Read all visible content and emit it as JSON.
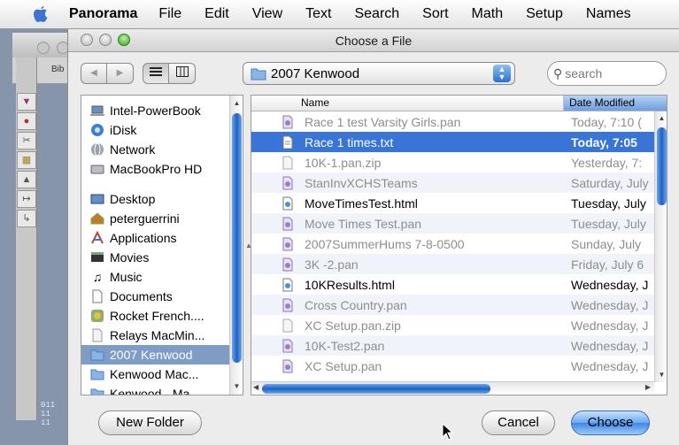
{
  "menubar": {
    "app": "Panorama",
    "items": [
      "File",
      "Edit",
      "View",
      "Text",
      "Search",
      "Sort",
      "Math",
      "Setup",
      "Names"
    ]
  },
  "background_window": {
    "title_fragment": "Bib",
    "code_fragment": "011\n11\n11"
  },
  "dialog": {
    "title": "Choose a File",
    "location": "2007 Kenwood",
    "search_placeholder": "search",
    "sidebar": {
      "devices": [
        {
          "label": "Intel-PowerBook",
          "icon": "laptop-icon"
        },
        {
          "label": "iDisk",
          "icon": "idisk-icon"
        },
        {
          "label": "Network",
          "icon": "network-icon"
        },
        {
          "label": "MacBookPro HD",
          "icon": "hard-drive-icon"
        }
      ],
      "places": [
        {
          "label": "Desktop",
          "icon": "desktop-icon"
        },
        {
          "label": "peterguerrini",
          "icon": "home-icon"
        },
        {
          "label": "Applications",
          "icon": "applications-icon"
        },
        {
          "label": "Movies",
          "icon": "movies-icon"
        },
        {
          "label": "Music",
          "icon": "music-icon"
        },
        {
          "label": "Documents",
          "icon": "documents-icon"
        },
        {
          "label": "Rocket French....",
          "icon": "app-icon"
        },
        {
          "label": "Relays MacMin...",
          "icon": "document-icon"
        },
        {
          "label": "2007 Kenwood",
          "icon": "folder-icon",
          "selected": true
        },
        {
          "label": "Kenwood Mac...",
          "icon": "folder-icon"
        },
        {
          "label": "Kenwood - Ma...",
          "icon": "folder-icon"
        }
      ]
    },
    "columns": {
      "name": "Name",
      "date": "Date Modified"
    },
    "files": [
      {
        "name": "Race 1 test Varsity Girls.pan",
        "date": "Today, 7:10 (",
        "enabled": false,
        "icon": "pan-file-icon"
      },
      {
        "name": "Race 1 times.txt",
        "date": "Today, 7:05",
        "enabled": true,
        "selected": true,
        "icon": "text-file-icon"
      },
      {
        "name": "10K-1.pan.zip",
        "date": "Yesterday, 7:",
        "enabled": false,
        "icon": "zip-file-icon"
      },
      {
        "name": "StanInvXCHSTeams",
        "date": "Saturday, July",
        "enabled": false,
        "icon": "pan-file-icon"
      },
      {
        "name": "MoveTimesTest.html",
        "date": "Tuesday, July",
        "enabled": true,
        "icon": "html-file-icon"
      },
      {
        "name": "Move Times Test.pan",
        "date": "Tuesday, July",
        "enabled": false,
        "icon": "pan-file-icon"
      },
      {
        "name": "2007SummerHums 7-8-0500",
        "date": "Sunday, July",
        "enabled": false,
        "icon": "pan-file-icon"
      },
      {
        "name": "3K -2.pan",
        "date": "Friday, July 6",
        "enabled": false,
        "icon": "pan-file-icon"
      },
      {
        "name": "10KResults.html",
        "date": "Wednesday, J",
        "enabled": true,
        "icon": "html-file-icon"
      },
      {
        "name": "Cross Country.pan",
        "date": "Wednesday, J",
        "enabled": false,
        "icon": "pan-file-icon"
      },
      {
        "name": "XC Setup.pan.zip",
        "date": "Wednesday, J",
        "enabled": false,
        "icon": "zip-file-icon"
      },
      {
        "name": "10K-Test2.pan",
        "date": "Wednesday, J",
        "enabled": false,
        "icon": "pan-file-icon"
      },
      {
        "name": "XC Setup.pan",
        "date": "Wednesday, J",
        "enabled": false,
        "icon": "pan-file-icon"
      }
    ],
    "buttons": {
      "new_folder": "New Folder",
      "cancel": "Cancel",
      "choose": "Choose"
    }
  },
  "colors": {
    "selection": "#3875d7",
    "sidebar_selection": "#7e9cc4",
    "accent": "#1f62c4"
  }
}
